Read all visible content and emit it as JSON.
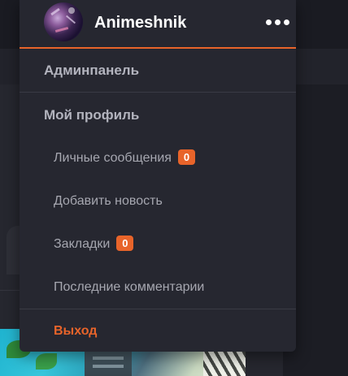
{
  "user": {
    "name": "Animeshnik",
    "avatar_icon": "avatar-icon",
    "more_icon": "more-dots-icon"
  },
  "menu": {
    "admin_panel": "Админпанель",
    "my_profile": "Мой профиль",
    "messages": {
      "label": "Личные сообщения",
      "count": "0"
    },
    "add_news": "Добавить новость",
    "bookmarks": {
      "label": "Закладки",
      "count": "0"
    },
    "recent_comments": "Последние комментарии",
    "logout": "Выход"
  },
  "colors": {
    "accent": "#e8642a",
    "panel": "#262730",
    "text_main": "#b3b4be",
    "text_sub": "#a6a7b0"
  }
}
